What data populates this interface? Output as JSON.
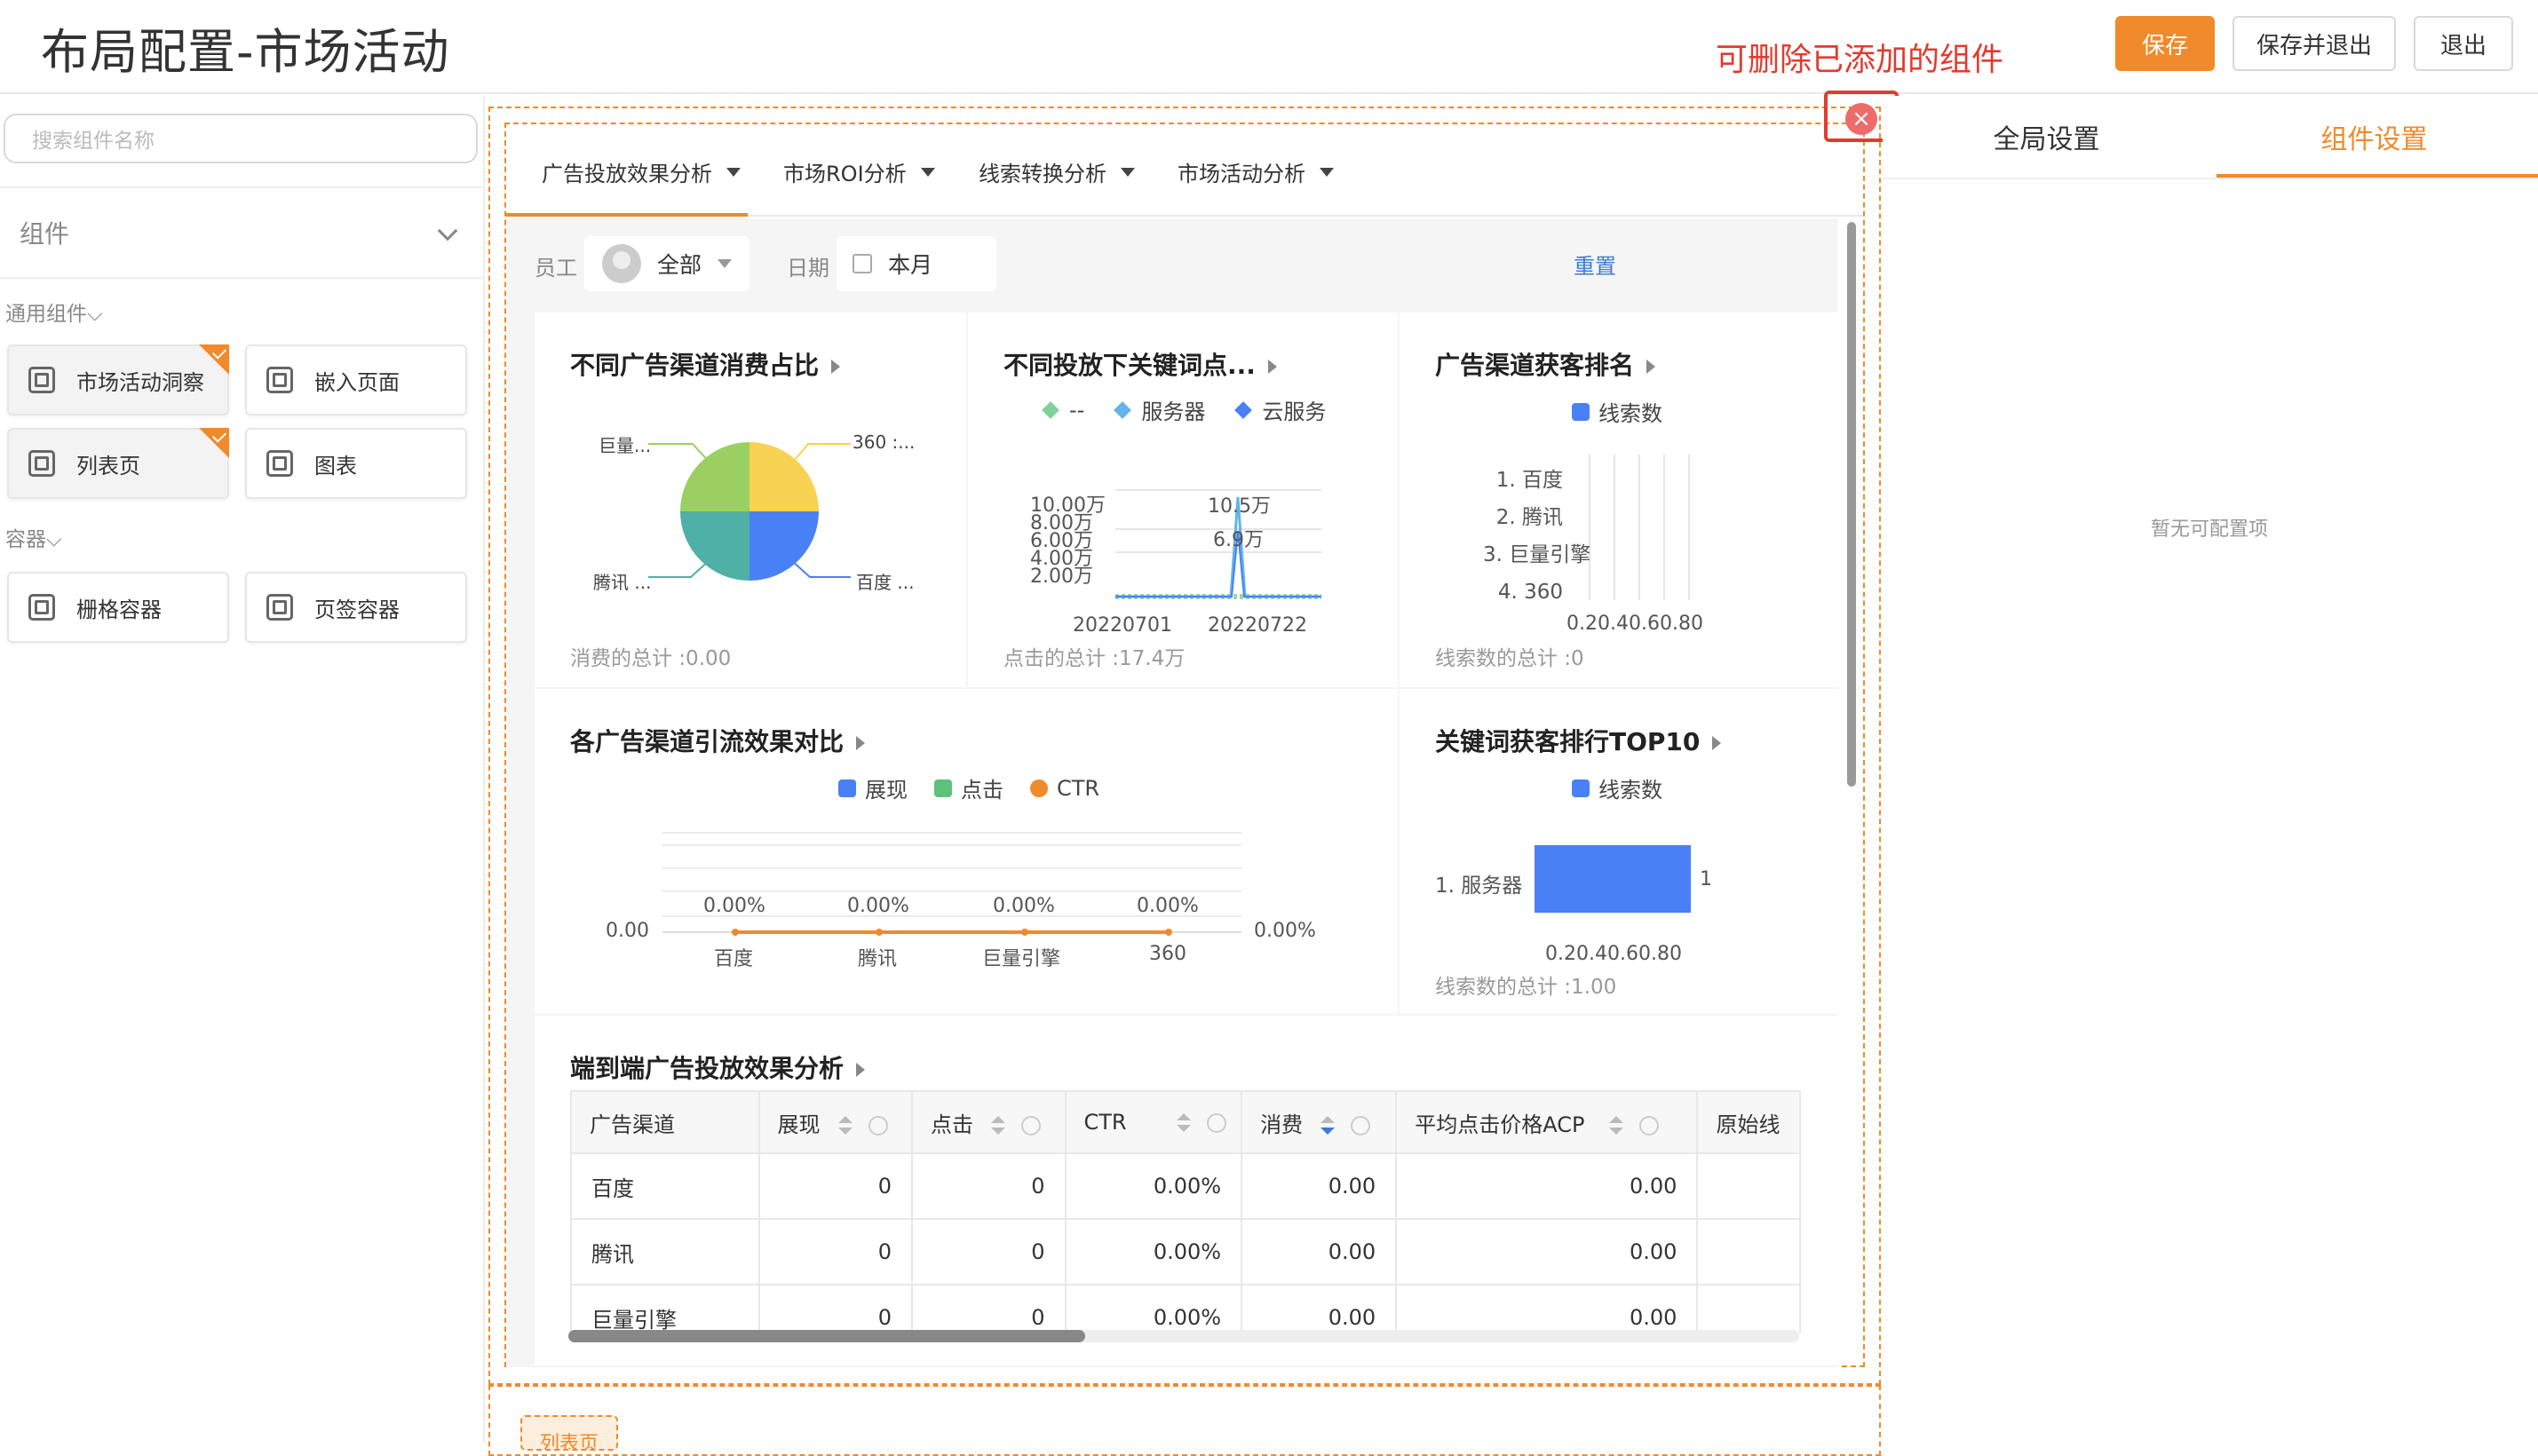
{
  "header": {
    "title": "布局配置-市场活动",
    "hint": "可删除已添加的组件",
    "buttons": {
      "save": "保存",
      "save_exit": "保存并退出",
      "exit": "退出"
    }
  },
  "sidebar": {
    "search_placeholder": "搜索组件名称",
    "section_title": "组件",
    "group_common": "通用组件",
    "group_container": "容器",
    "components": [
      {
        "label": "市场活动洞察"
      },
      {
        "label": "嵌入页面"
      },
      {
        "label": "列表页"
      },
      {
        "label": "图表"
      },
      {
        "label": "栅格容器"
      },
      {
        "label": "页签容器"
      }
    ]
  },
  "canvas": {
    "tabs": [
      "广告投放效果分析",
      "市场ROI分析",
      "线索转换分析",
      "市场活动分析"
    ],
    "filters": {
      "employee_label": "员工",
      "employee_value": "全部",
      "date_label": "日期",
      "date_value": "本月",
      "reset": "重置"
    },
    "lower_tag": "列表页",
    "close_symbol": "×"
  },
  "cards": {
    "pie": {
      "title": "不同广告渠道消费占比",
      "labels": {
        "juliang": "巨量...",
        "c360": "360 :...",
        "tengxun": "腾讯 ...",
        "baidu": "百度 ..."
      },
      "footnote": "消费的总计 :0.00"
    },
    "keyword_line": {
      "title": "不同投放下关键词点...",
      "legend": [
        "-- ",
        "服务器",
        "云服务"
      ],
      "yticks": [
        "10.00万",
        "8.00万",
        "6.00万",
        "4.00万",
        "2.00万"
      ],
      "xticks": [
        "20220701",
        "20220722"
      ],
      "peak_labels": [
        "10.5万",
        "6.9万"
      ],
      "footnote": "点击的总计 :17.4万"
    },
    "channel_rank": {
      "title": "广告渠道获客排名",
      "legend": "线索数",
      "rows": [
        "1. 百度",
        "2. 腾讯",
        "3. 巨量引擎",
        "4. 360"
      ],
      "xticks": "0.20.40.60.80",
      "footnote": "线索数的总计 :0"
    },
    "traffic": {
      "title": "各广告渠道引流效果对比",
      "legend": [
        "展现",
        "点击",
        "CTR"
      ],
      "y_left": "0.00",
      "y_right": "0.00%",
      "categories": [
        "百度",
        "腾讯",
        "巨量引擎",
        "360"
      ],
      "values": [
        "0.00%",
        "0.00%",
        "0.00%",
        "0.00%"
      ]
    },
    "keyword_top": {
      "title": "关键词获客排行TOP10",
      "legend": "线索数",
      "row": "1. 服务器",
      "value": "1",
      "xticks": "0.20.40.60.80",
      "footnote": "线索数的总计 :1.00"
    },
    "table": {
      "title": "端到端广告投放效果分析",
      "headers": [
        "广告渠道",
        "展现",
        "点击",
        "CTR",
        "消费",
        "平均点击价格ACP",
        "原始线"
      ],
      "rows": [
        [
          "百度",
          "0",
          "0",
          "0.00%",
          "0.00",
          "0.00"
        ],
        [
          "腾讯",
          "0",
          "0",
          "0.00%",
          "0.00",
          "0.00"
        ],
        [
          "巨量引擎",
          "0",
          "0",
          "0.00%",
          "0.00",
          "0.00"
        ]
      ]
    }
  },
  "right_panel": {
    "tabs": [
      "全局设置",
      "组件设置"
    ],
    "empty": "暂无可配置项"
  },
  "colors": {
    "accent": "#f08a2a",
    "blue": "#4a80f5",
    "green": "#5cc27a",
    "alert": "#e23b2e"
  }
}
